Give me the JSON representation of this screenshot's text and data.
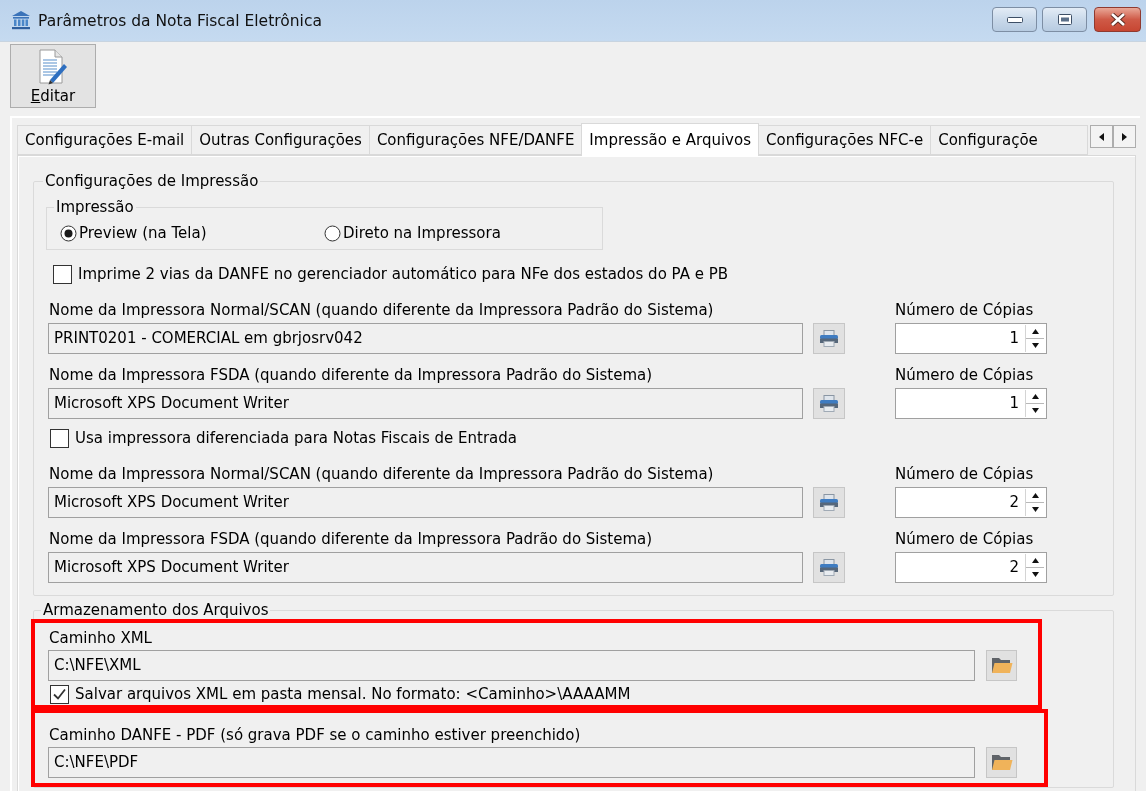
{
  "window": {
    "title": "Parâmetros da Nota Fiscal Eletrônica"
  },
  "toolbar": {
    "buttons": [
      {
        "label": "Editar",
        "mnemonic_underlined": true
      }
    ]
  },
  "tabs": [
    {
      "label": "Configurações E-mail",
      "selected": false
    },
    {
      "label": "Outras Configurações",
      "selected": false
    },
    {
      "label": "Configurações NFE/DANFE",
      "selected": false
    },
    {
      "label": "Impressão e Arquivos",
      "selected": true
    },
    {
      "label": "Configurações NFC-e",
      "selected": false
    },
    {
      "label": "Configuraçõe",
      "selected": false
    }
  ],
  "print_settings": {
    "title": "Configurações de Impressão",
    "mode_group": {
      "title": "Impressão",
      "options": [
        {
          "label": "Preview (na Tela)",
          "selected": true
        },
        {
          "label": "Direto na Impressora",
          "selected": false
        }
      ]
    },
    "items": [
      {
        "kind": "checkbox",
        "label": "Imprime 2 vias da DANFE no gerenciador automático para NFe dos estados do PA e PB",
        "checked": false
      },
      {
        "kind": "printer",
        "label": "Nome da Impressora Normal/SCAN (quando diferente da Impressora Padrão do Sistema)",
        "value": "PRINT0201 - COMERCIAL em gbrjosrv042",
        "copies_label": "Número de Cópias",
        "copies": "1"
      },
      {
        "kind": "printer",
        "label": "Nome da Impressora FSDA (quando diferente da Impressora Padrão do Sistema)",
        "value": "Microsoft XPS Document Writer",
        "copies_label": "Número de Cópias",
        "copies": "1"
      },
      {
        "kind": "checkbox",
        "label": "Usa impressora diferenciada para Notas Fiscais de Entrada",
        "checked": false
      },
      {
        "kind": "printer",
        "label": "Nome da Impressora Normal/SCAN (quando diferente da Impressora Padrão do Sistema)",
        "value": "Microsoft XPS Document Writer",
        "copies_label": "Número de Cópias",
        "copies": "2"
      },
      {
        "kind": "printer",
        "label": "Nome da Impressora FSDA (quando diferente da Impressora Padrão do Sistema)",
        "value": "Microsoft XPS Document Writer",
        "copies_label": "Número de Cópias",
        "copies": "2"
      }
    ]
  },
  "storage": {
    "title": "Armazenamento dos Arquivos",
    "paths": [
      {
        "label": "Caminho XML",
        "value": "C:\\NFE\\XML",
        "highlighted": true,
        "option": {
          "label": "Salvar arquivos XML em pasta mensal. No formato: <Caminho>\\AAAAMM",
          "checked": true
        }
      },
      {
        "label": "Caminho DANFE - PDF (só grava PDF se o caminho estiver preenchido)",
        "value": "C:\\NFE\\PDF",
        "highlighted": true
      }
    ]
  }
}
